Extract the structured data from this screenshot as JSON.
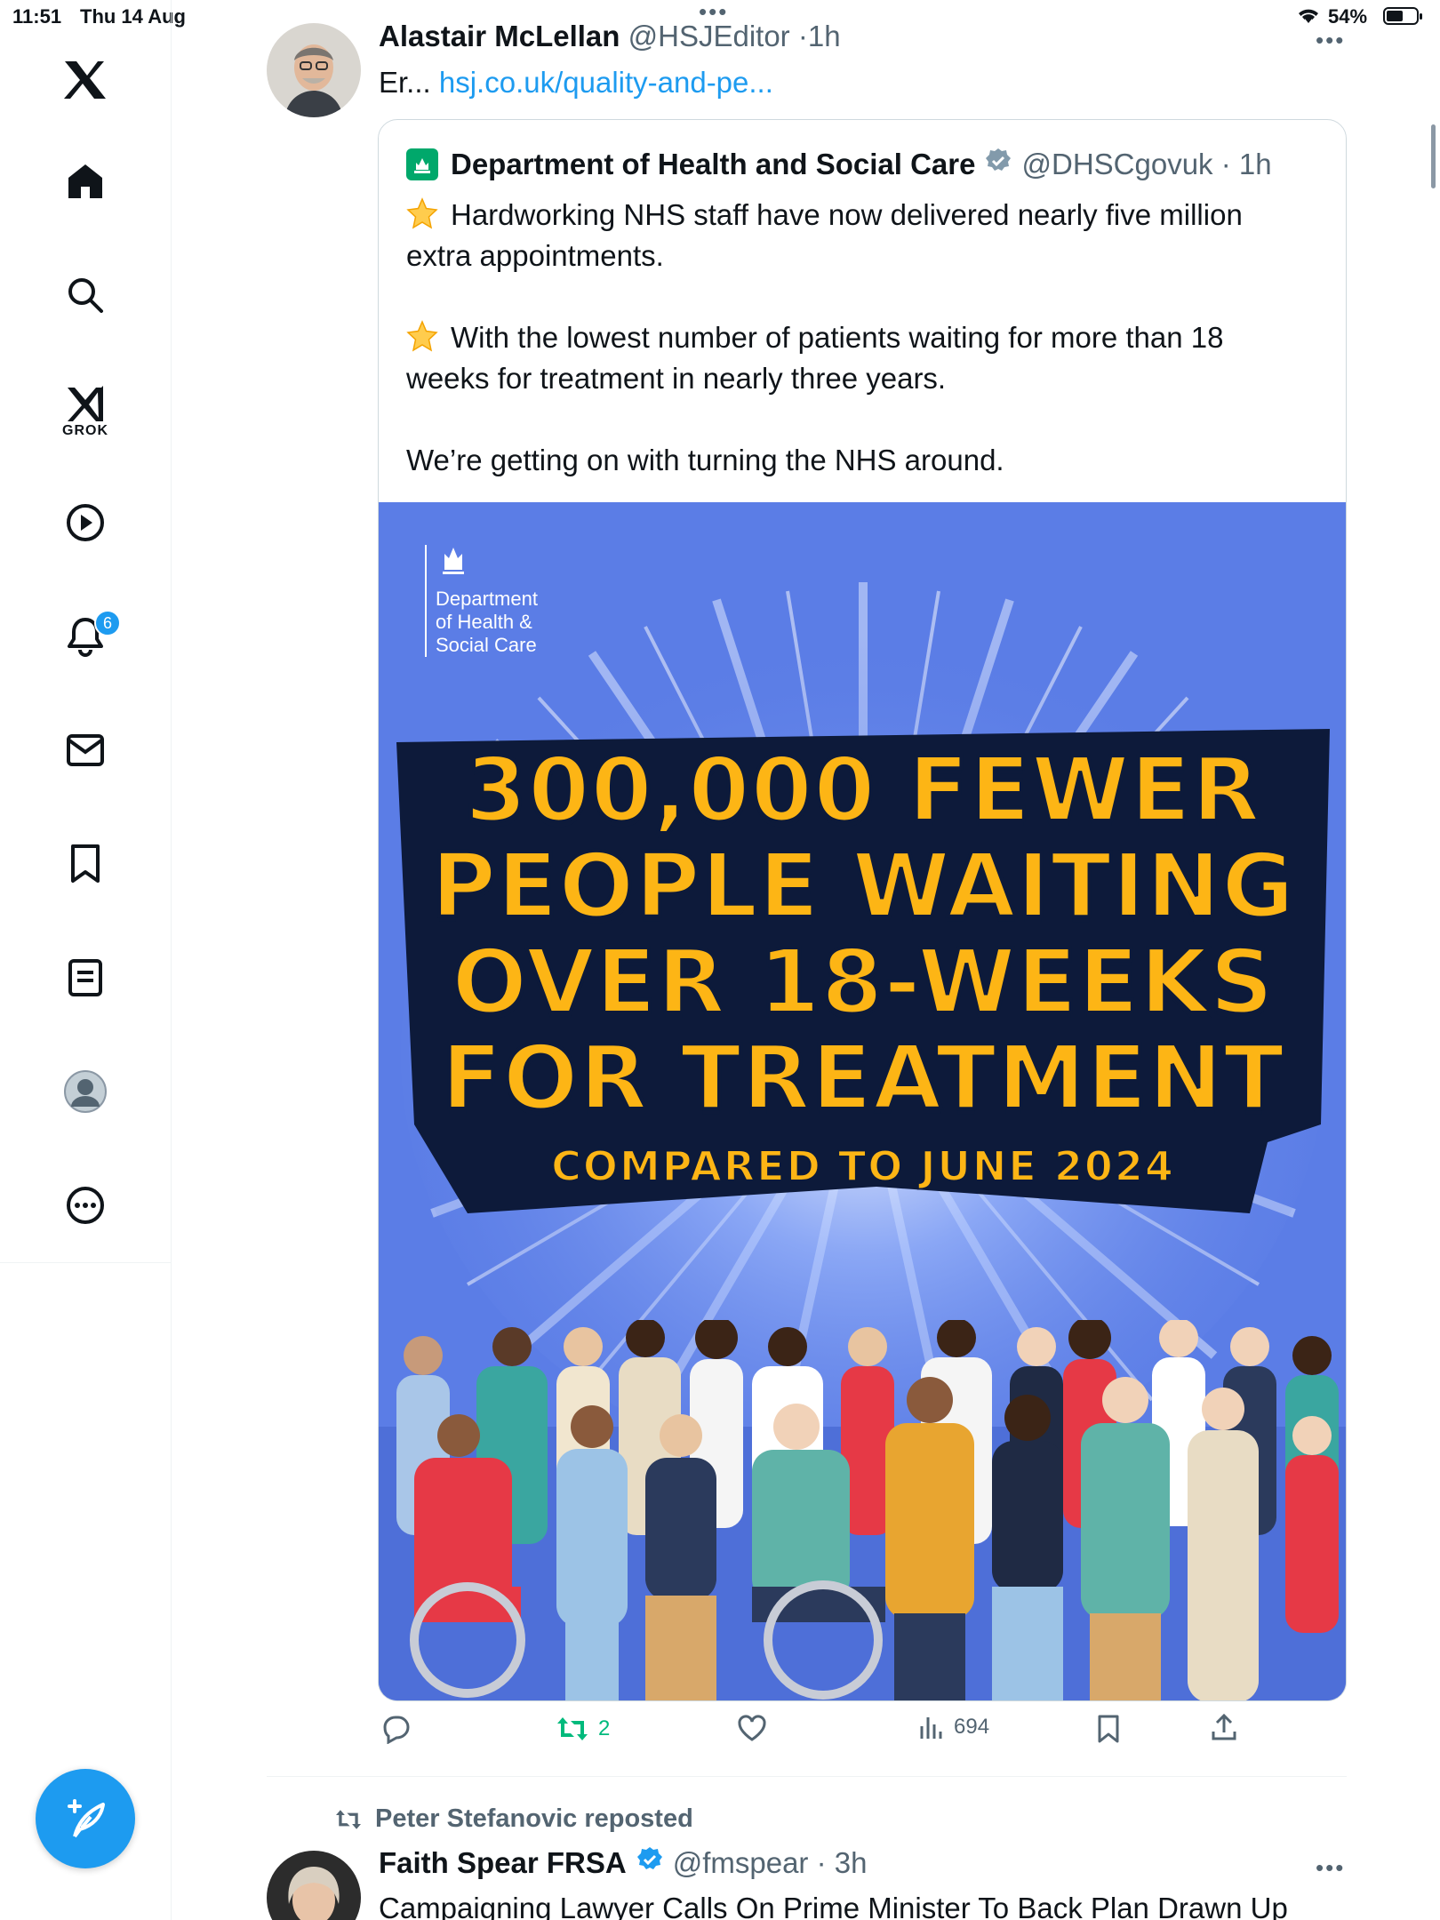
{
  "status_bar": {
    "time": "11:51",
    "date": "Thu 14 Aug",
    "battery": "54%"
  },
  "sidebar": {
    "items": [
      {
        "name": "x-logo",
        "label": "X"
      },
      {
        "name": "home",
        "label": "Home"
      },
      {
        "name": "search",
        "label": "Search"
      },
      {
        "name": "grok",
        "label": "GROK"
      },
      {
        "name": "video",
        "label": "Video"
      },
      {
        "name": "notifications",
        "label": "Notifications",
        "badge": "6"
      },
      {
        "name": "messages",
        "label": "Messages"
      },
      {
        "name": "bookmarks",
        "label": "Bookmarks"
      },
      {
        "name": "lists",
        "label": "Lists"
      },
      {
        "name": "profile",
        "label": "Profile"
      },
      {
        "name": "more",
        "label": "More"
      }
    ],
    "accent_color": "#1d9bf0"
  },
  "tweet": {
    "author_name": "Alastair McLellan",
    "handle": "@HSJEditor",
    "time": "1h",
    "text_prefix": "Er...",
    "link": "hsj.co.uk/quality-and-pe...",
    "quote": {
      "author_name": "Department of Health and Social Care",
      "handle": "@DHSCgovuk",
      "time": "1h",
      "paragraph1": "Hardworking NHS staff have now delivered nearly five million extra appointments.",
      "paragraph2": "With the lowest number of patients waiting for more than 18 weeks for treatment in nearly three years.",
      "paragraph3": "We’re getting on with turning the NHS around.",
      "image": {
        "logo_line1": "Department",
        "logo_line2": "of Health &",
        "logo_line3": "Social Care",
        "headline_line1": "300,000 FEWER",
        "headline_line2": "PEOPLE WAITING",
        "headline_line3": "OVER 18-WEEKS",
        "headline_line4": "FOR TREATMENT",
        "subline": "COMPARED TO JUNE 2024",
        "bg_color": "#5b7de6",
        "text_color": "#fdb515"
      }
    },
    "actions": {
      "reply_count": "",
      "retweet_count": "2",
      "like_count": "",
      "views": "694"
    }
  },
  "next_tweet": {
    "reposted_by": "Peter Stefanovic reposted",
    "author_name": "Faith Spear FRSA",
    "handle": "@fmspear",
    "time": "3h",
    "text": "Campaigning Lawyer Calls On Prime Minister To Back Plan Drawn Up"
  }
}
